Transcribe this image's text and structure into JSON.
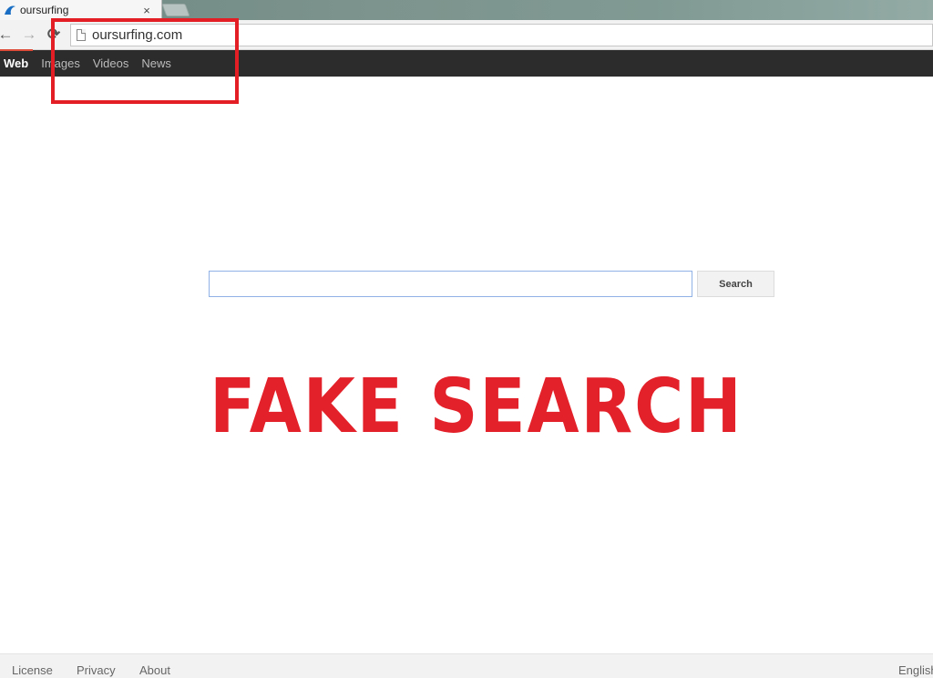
{
  "browser": {
    "tab": {
      "title": "oursurfing",
      "close_glyph": "×",
      "favicon": "surf-wave-icon"
    },
    "toolbar": {
      "back_glyph": "←",
      "forward_glyph": "→",
      "reload_glyph": "⟳",
      "url": "oursurfing.com"
    }
  },
  "nav": {
    "items": [
      {
        "label": "Web",
        "active": true
      },
      {
        "label": "Images",
        "active": false
      },
      {
        "label": "Videos",
        "active": false
      },
      {
        "label": "News",
        "active": false
      }
    ]
  },
  "search": {
    "value": "",
    "placeholder": "",
    "button_label": "Search"
  },
  "overlay": {
    "text": "FAKE SEARCH",
    "color": "#e3212a",
    "annotation_box_color": "#e31e25"
  },
  "footer": {
    "links": [
      "License",
      "Privacy",
      "About"
    ],
    "language": "English"
  }
}
